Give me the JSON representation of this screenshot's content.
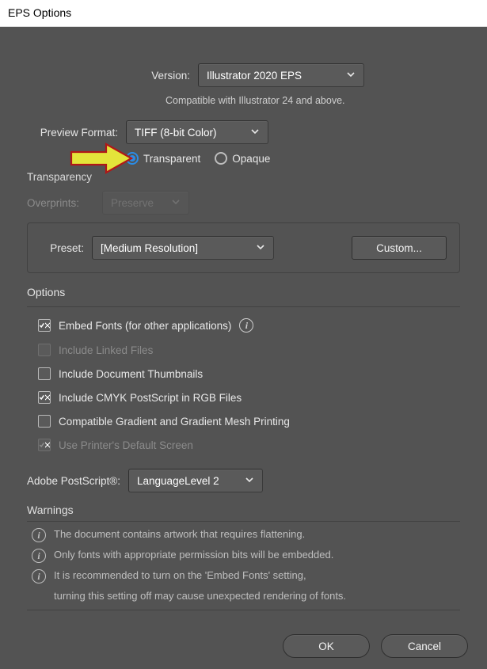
{
  "window": {
    "title": "EPS Options"
  },
  "version": {
    "label": "Version:",
    "value": "Illustrator 2020 EPS",
    "helptext": "Compatible with Illustrator 24 and above."
  },
  "preview": {
    "label": "Preview Format:",
    "value": "TIFF (8-bit Color)",
    "transparent": "Transparent",
    "opaque": "Opaque"
  },
  "transparency": {
    "section": "Transparency",
    "overprints_label": "Overprints:",
    "overprints_value": "Preserve",
    "preset_label": "Preset:",
    "preset_value": "[Medium Resolution]",
    "custom": "Custom..."
  },
  "options": {
    "section": "Options",
    "embed_fonts": "Embed Fonts (for other applications)",
    "include_linked": "Include Linked Files",
    "include_thumbs": "Include Document Thumbnails",
    "include_cmyk": "Include CMYK PostScript in RGB Files",
    "compat_gradient": "Compatible Gradient and Gradient Mesh Printing",
    "printer_default": "Use Printer's Default Screen",
    "postscript_label": "Adobe PostScript®:",
    "postscript_value": "LanguageLevel 2"
  },
  "warnings": {
    "section": "Warnings",
    "w1": "The document contains artwork that requires flattening.",
    "w2": "Only fonts with appropriate permission bits will be embedded.",
    "w3a": "It is recommended to turn on the 'Embed Fonts' setting,",
    "w3b": "turning this setting off may cause unexpected rendering of fonts."
  },
  "buttons": {
    "ok": "OK",
    "cancel": "Cancel"
  }
}
